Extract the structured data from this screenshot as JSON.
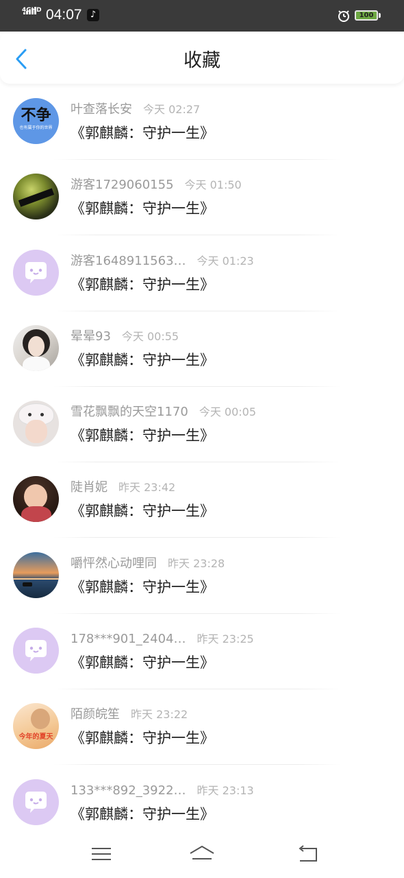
{
  "status_bar": {
    "network": "4GHD",
    "time": "04:07",
    "battery": "100",
    "icons": [
      "signal-icon",
      "tiktok-icon",
      "alarm-icon",
      "battery-icon"
    ]
  },
  "header": {
    "title": "收藏",
    "back_icon": "chevron-left-icon",
    "accent_color": "#2a9df4"
  },
  "items": [
    {
      "name": "叶查落长安",
      "time": "今天 02:27",
      "subject": "《郭麒麟：守护一生》",
      "avatar": "avatar-text-badge",
      "avatar_text": "不争",
      "avatar_subtext": "也有属于你的世界"
    },
    {
      "name": "游客1729060155",
      "time": "今天 01:50",
      "subject": "《郭麒麟：守护一生》",
      "avatar": "avatar-photo-grass"
    },
    {
      "name": "游客1648911563…",
      "time": "今天 01:23",
      "subject": "《郭麒麟：守护一生》",
      "avatar": "avatar-default-chat"
    },
    {
      "name": "晕晕93",
      "time": "今天 00:55",
      "subject": "《郭麒麟：守护一生》",
      "avatar": "avatar-photo-girl"
    },
    {
      "name": "雪花飘飘的天空1170",
      "time": "今天 00:05",
      "subject": "《郭麒麟：守护一生》",
      "avatar": "avatar-photo-bunny"
    },
    {
      "name": "陡肖妮",
      "time": "昨天 23:42",
      "subject": "《郭麒麟：守护一生》",
      "avatar": "avatar-photo-baby"
    },
    {
      "name": "嚼怦然心动哩同",
      "time": "昨天 23:28",
      "subject": "《郭麒麟：守护一生》",
      "avatar": "avatar-photo-sunset"
    },
    {
      "name": "178***901_2404…",
      "time": "昨天 23:25",
      "subject": "《郭麒麟：守护一生》",
      "avatar": "avatar-default-chat"
    },
    {
      "name": "陌颜皖笙",
      "time": "昨天 23:22",
      "subject": "《郭麒麟：守护一生》",
      "avatar": "avatar-photo-summer",
      "avatar_text": "今年的夏天"
    },
    {
      "name": "133***892_3922…",
      "time": "昨天 23:13",
      "subject": "《郭麒麟：守护一生》",
      "avatar": "avatar-default-chat"
    }
  ],
  "bottom_nav": {
    "icons": [
      "menu-icon",
      "home-icon",
      "back-icon"
    ]
  }
}
